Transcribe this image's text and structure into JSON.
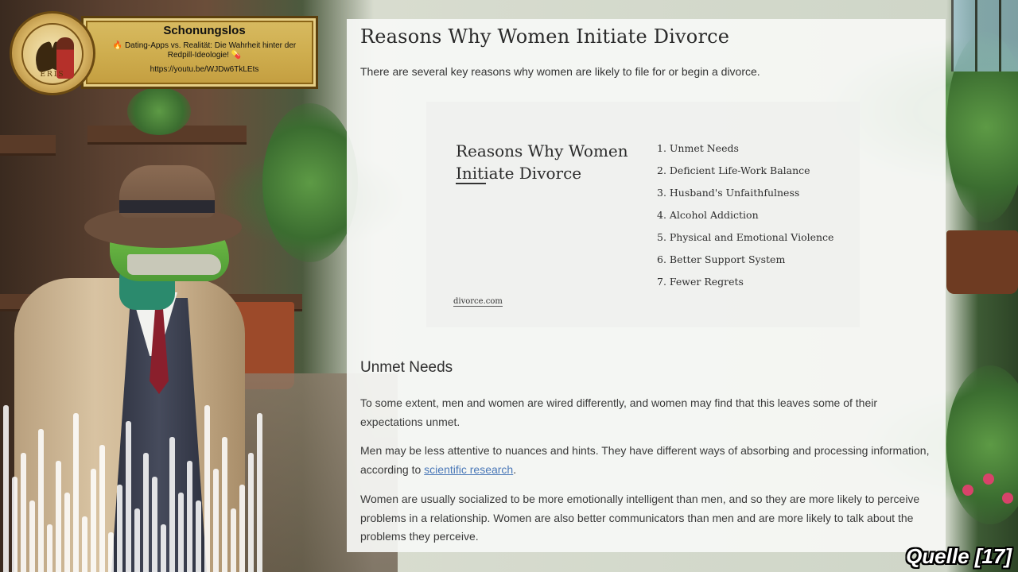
{
  "banner": {
    "channel_name": "Schonungslos",
    "video_title": "🔥 Dating-Apps vs. Realität: Die Wahrheit hinter der Redpill-Ideologie! 💊",
    "video_link": "https://youtu.be/WJDw6TkLEts",
    "seal_text": "ERIS"
  },
  "article": {
    "title": "Reasons Why Women Initiate Divorce",
    "intro": "There are several key reasons why women are likely to file for or begin a divorce.",
    "infographic": {
      "title": "Reasons Why Women Initiate Divorce",
      "items": [
        "1. Unmet Needs",
        "2. Deficient Life-Work Balance",
        "3. Husband's Unfaithfulness",
        "4. Alcohol Addiction",
        "5. Physical and Emotional Violence",
        "6. Better Support System",
        "7. Fewer Regrets"
      ],
      "source": "divorce.com"
    },
    "section_heading": "Unmet Needs",
    "paragraphs": {
      "p1": "To some extent, men and women are wired differently, and women may find that this leaves some of their expectations unmet.",
      "p2_before": "Men may be less attentive to nuances and hints. They have different ways of absorbing and processing information, according to ",
      "p2_link": "scientific research",
      "p2_after": ".",
      "p3": "Women are usually socialized to be more emotionally intelligent than men, and so they are more likely to perceive problems in a relationship. Women are also better communicators than men and are more likely to talk about the problems they perceive."
    }
  },
  "source_label": "Quelle [17]",
  "colors": {
    "link": "#4a78b8",
    "banner_gold": "#cfae4f",
    "panel_bg": "#f6f7f5"
  }
}
